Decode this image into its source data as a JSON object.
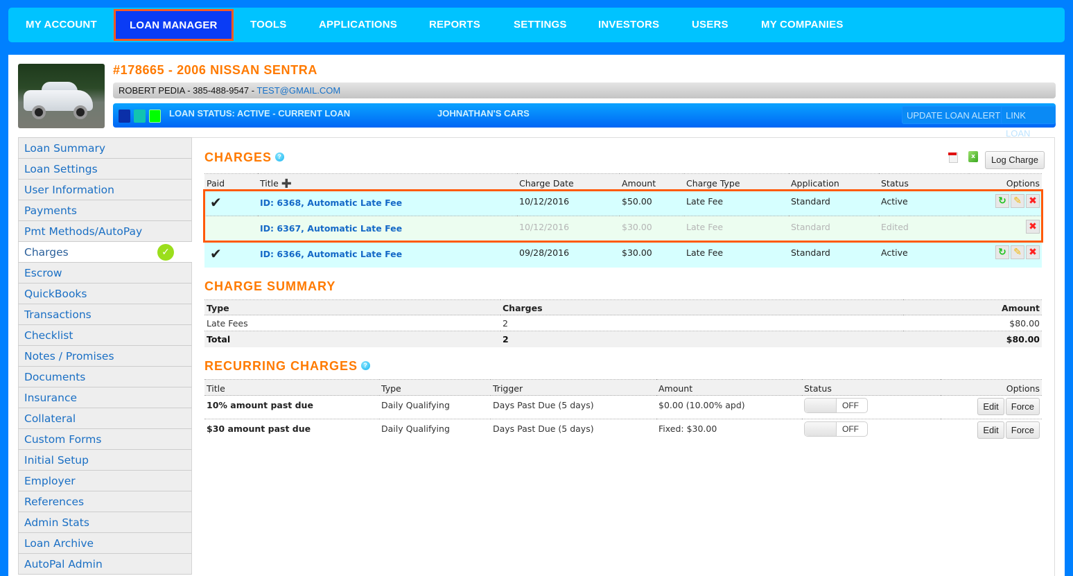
{
  "topnav": {
    "items": [
      {
        "label": "MY ACCOUNT"
      },
      {
        "label": "LOAN MANAGER",
        "active": true
      },
      {
        "label": "TOOLS"
      },
      {
        "label": "APPLICATIONS"
      },
      {
        "label": "REPORTS"
      },
      {
        "label": "SETTINGS"
      },
      {
        "label": "INVESTORS"
      },
      {
        "label": "USERS"
      },
      {
        "label": "MY COMPANIES"
      }
    ]
  },
  "loan": {
    "title": "#178665 - 2006 NISSAN SENTRA",
    "borrower": "ROBERT PEDIA - 385-488-9547 - ",
    "email": "TEST@GMAIL.COM",
    "status": "LOAN STATUS: ACTIVE - CURRENT LOAN",
    "dealer": "JOHNATHAN'S CARS",
    "swatch_colors": [
      "#0b2fa8",
      "#12c4b0",
      "#00ff00"
    ],
    "buttons": {
      "update_alert": "UPDATE LOAN ALERT",
      "link_loan": "LINK LOAN"
    }
  },
  "sidebar": {
    "items": [
      {
        "label": "Loan Summary"
      },
      {
        "label": "Loan Settings"
      },
      {
        "label": "User Information"
      },
      {
        "label": "Payments"
      },
      {
        "label": "Pmt Methods/AutoPay"
      },
      {
        "label": "Charges",
        "active": true
      },
      {
        "label": "Escrow"
      },
      {
        "label": "QuickBooks"
      },
      {
        "label": "Transactions"
      },
      {
        "label": "Checklist"
      },
      {
        "label": "Notes / Promises"
      },
      {
        "label": "Documents"
      },
      {
        "label": "Insurance"
      },
      {
        "label": "Collateral"
      },
      {
        "label": "Custom Forms"
      },
      {
        "label": "Initial Setup"
      },
      {
        "label": "Employer"
      },
      {
        "label": "References"
      },
      {
        "label": "Admin Stats"
      },
      {
        "label": "Loan Archive"
      },
      {
        "label": "AutoPal Admin"
      }
    ]
  },
  "charges": {
    "title": "CHARGES",
    "log_charge_label": "Log Charge",
    "headers": {
      "paid": "Paid",
      "title": "Title",
      "charge_date": "Charge Date",
      "amount": "Amount",
      "charge_type": "Charge Type",
      "application": "Application",
      "status": "Status",
      "options": "Options"
    },
    "rows": [
      {
        "paid": true,
        "title": "ID: 6368, Automatic Late Fee",
        "charge_date": "10/12/2016",
        "amount": "$50.00",
        "charge_type": "Late Fee",
        "application": "Standard",
        "status": "Active",
        "options": [
          "refresh",
          "edit",
          "delete"
        ]
      },
      {
        "paid": false,
        "title": "ID: 6367, Automatic Late Fee",
        "charge_date": "10/12/2016",
        "amount": "$30.00",
        "charge_type": "Late Fee",
        "application": "Standard",
        "status": "Edited",
        "options": [
          "delete"
        ]
      },
      {
        "paid": true,
        "title": "ID: 6366, Automatic Late Fee",
        "charge_date": "09/28/2016",
        "amount": "$30.00",
        "charge_type": "Late Fee",
        "application": "Standard",
        "status": "Active",
        "options": [
          "refresh",
          "edit",
          "delete"
        ]
      }
    ]
  },
  "summary": {
    "title": "CHARGE SUMMARY",
    "headers": {
      "type": "Type",
      "charges": "Charges",
      "amount": "Amount"
    },
    "rows": [
      {
        "type": "Late Fees",
        "charges": "2",
        "amount": "$80.00"
      }
    ],
    "total": {
      "type": "Total",
      "charges": "2",
      "amount": "$80.00"
    }
  },
  "recurring": {
    "title": "RECURRING CHARGES",
    "headers": {
      "title": "Title",
      "type": "Type",
      "trigger": "Trigger",
      "amount": "Amount",
      "status": "Status",
      "options": "Options"
    },
    "rows": [
      {
        "title": "10% amount past due",
        "type": "Daily Qualifying",
        "trigger": "Days Past Due (5 days)",
        "amount": "$0.00 (10.00% apd)",
        "status": "OFF"
      },
      {
        "title": "$30 amount past due",
        "type": "Daily Qualifying",
        "trigger": "Days Past Due (5 days)",
        "amount": "Fixed: $30.00",
        "status": "OFF"
      }
    ],
    "edit_label": "Edit",
    "force_label": "Force"
  },
  "icons": {
    "paid_check": "✔",
    "delete": "✖",
    "edit": "✎",
    "refresh": "↻",
    "help": "?",
    "sort": "✚"
  }
}
